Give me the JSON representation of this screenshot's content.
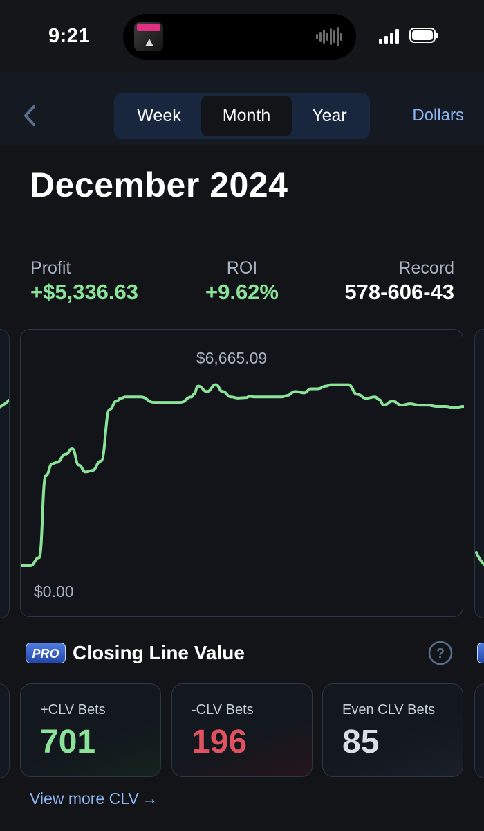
{
  "status_bar": {
    "time": "9:21"
  },
  "nav": {
    "tabs": [
      {
        "label": "Week"
      },
      {
        "label": "Month"
      },
      {
        "label": "Year"
      }
    ],
    "selected_tab": "Month",
    "units_label": "Dollars"
  },
  "period_title": "December 2024",
  "stats": {
    "profit": {
      "label": "Profit",
      "value": "+$5,336.63"
    },
    "roi": {
      "label": "ROI",
      "value": "+9.62%"
    },
    "record": {
      "label": "Record",
      "value": "578-606-43"
    }
  },
  "chart_data": {
    "type": "line",
    "peak_label": "$6,665.09",
    "baseline_label": "$0.00",
    "ylim": [
      0,
      6665.09
    ],
    "colors": {
      "line": "#8be39a"
    },
    "series": [
      {
        "x": [
          0,
          0.02,
          0.04,
          0.055,
          0.07,
          0.08,
          0.1,
          0.115,
          0.13,
          0.145,
          0.16,
          0.18,
          0.2,
          0.215,
          0.225,
          0.235,
          0.25,
          0.27,
          0.3,
          0.33,
          0.36,
          0.385,
          0.39,
          0.4,
          0.42,
          0.44,
          0.455,
          0.475,
          0.49,
          0.5,
          0.51,
          0.515,
          0.53,
          0.55,
          0.57,
          0.59,
          0.6,
          0.62,
          0.64,
          0.655,
          0.67,
          0.69,
          0.7,
          0.72,
          0.74,
          0.76,
          0.78,
          0.8,
          0.81,
          0.82,
          0.84,
          0.86,
          0.88,
          0.9,
          0.92,
          0.94,
          0.96,
          0.98,
          1.0
        ],
        "y": [
          0,
          0,
          300,
          3300,
          3750,
          3800,
          4100,
          4300,
          3700,
          3450,
          3500,
          3850,
          5750,
          6050,
          6150,
          6200,
          6200,
          6200,
          6000,
          6000,
          6000,
          6200,
          6300,
          6600,
          6400,
          6650,
          6400,
          6200,
          6160,
          6170,
          6180,
          6220,
          6200,
          6200,
          6200,
          6200,
          6250,
          6400,
          6350,
          6500,
          6500,
          6600,
          6650,
          6650,
          6650,
          6300,
          6150,
          6200,
          6100,
          5900,
          6050,
          5900,
          5950,
          5900,
          5900,
          5850,
          5850,
          5800,
          5850
        ]
      }
    ]
  },
  "clv": {
    "badge": "PRO",
    "title": "Closing Line Value",
    "cards": [
      {
        "label": "+CLV Bets",
        "value": "701"
      },
      {
        "label": "-CLV Bets",
        "value": "196"
      },
      {
        "label": "Even CLV Bets",
        "value": "85"
      }
    ],
    "view_more": "View more CLV →"
  }
}
